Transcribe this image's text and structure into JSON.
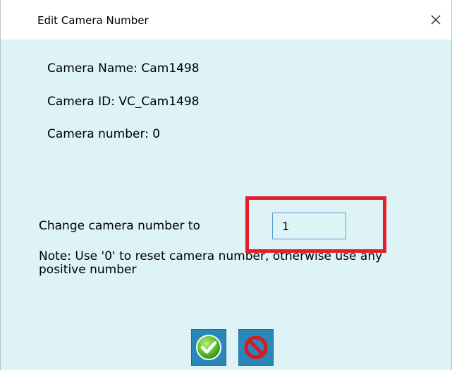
{
  "window": {
    "title": "Edit Camera Number",
    "close_glyph": "×"
  },
  "info": {
    "camera_name": "Camera Name: Cam1498",
    "camera_id": "Camera ID: VC_Cam1498",
    "camera_number": "Camera number: 0"
  },
  "form": {
    "change_label": "Change camera number to",
    "new_number_value": "1",
    "note": "Note: Use '0' to reset camera number, otherwise use any positive number"
  },
  "buttons": {
    "ok_icon": "green-checkmark-icon",
    "cancel_icon": "red-prohibited-icon"
  },
  "colors": {
    "dialog_background": "#ddf3f5",
    "highlight": "#e3202a",
    "input_border": "#5b9bd5",
    "button_background": "#2a87b8"
  }
}
